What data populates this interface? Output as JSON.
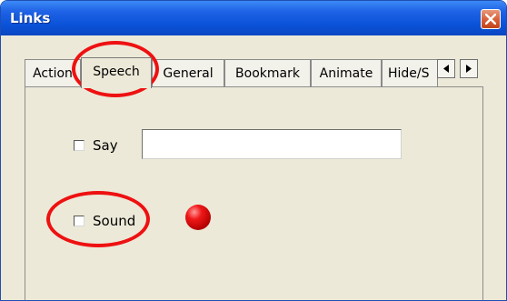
{
  "window": {
    "title": "Links"
  },
  "tabs": [
    {
      "label": "Action",
      "active": false
    },
    {
      "label": "Speech",
      "active": true
    },
    {
      "label": "General",
      "active": false
    },
    {
      "label": "Bookmark",
      "active": false
    },
    {
      "label": "Animate",
      "active": false
    },
    {
      "label": "Hide/S",
      "active": false
    }
  ],
  "speech": {
    "say": {
      "label": "Say",
      "checked": false,
      "value": ""
    },
    "sound": {
      "label": "Sound",
      "checked": false,
      "indicator_color": "#e01010"
    }
  },
  "annotation_color": "#ee1111"
}
